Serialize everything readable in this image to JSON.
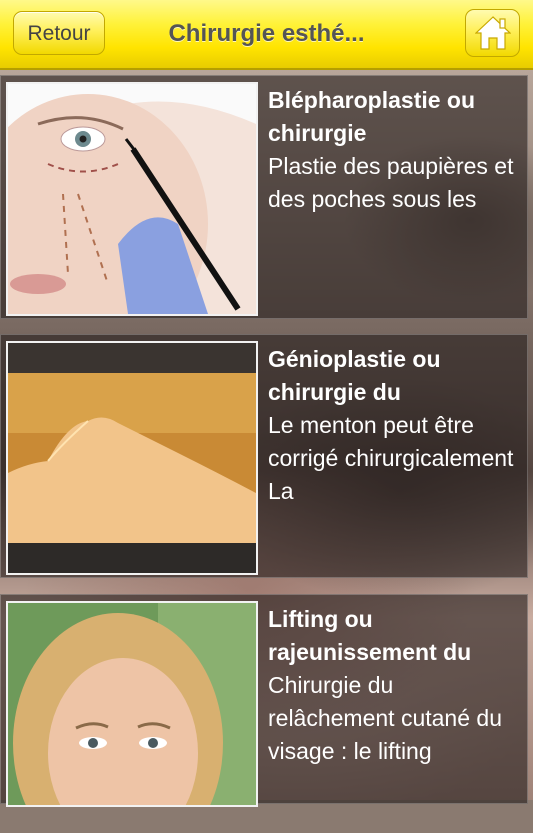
{
  "header": {
    "back_label": "Retour",
    "title": "Chirurgie esthé...",
    "home_icon": "home-icon"
  },
  "items": [
    {
      "title": "Blépharoplastie ou chirurgie",
      "desc": "Plastie des paupières et des poches sous les"
    },
    {
      "title": "Génioplastie ou chirurgie du",
      "desc": "Le menton peut être corrigé chirurgicalement La"
    },
    {
      "title": "Lifting ou rajeunissement du",
      "desc": "Chirurgie du relâchement cutané du visage : le lifting"
    }
  ]
}
